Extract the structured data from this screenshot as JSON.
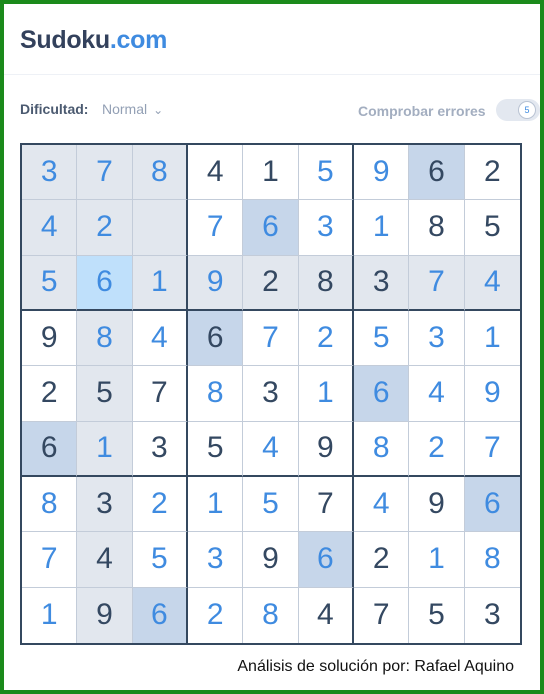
{
  "header": {
    "logo_text": "Sudoku",
    "logo_suffix": ".com"
  },
  "toolbar": {
    "difficulty_label": "Dificultad:",
    "difficulty_value": "Normal",
    "check_errors_label": "Comprobar errores",
    "check_errors_toggle_glyph": "5"
  },
  "board": {
    "rows": [
      [
        {
          "v": "3",
          "t": "user",
          "bg": "hl"
        },
        {
          "v": "7",
          "t": "user",
          "bg": "hl"
        },
        {
          "v": "8",
          "t": "user",
          "bg": "hl"
        },
        {
          "v": "4",
          "t": "given",
          "bg": ""
        },
        {
          "v": "1",
          "t": "given",
          "bg": ""
        },
        {
          "v": "5",
          "t": "user",
          "bg": ""
        },
        {
          "v": "9",
          "t": "user",
          "bg": ""
        },
        {
          "v": "6",
          "t": "given",
          "bg": "same"
        },
        {
          "v": "2",
          "t": "given",
          "bg": ""
        }
      ],
      [
        {
          "v": "4",
          "t": "user",
          "bg": "hl"
        },
        {
          "v": "2",
          "t": "user",
          "bg": "hl"
        },
        {
          "v": "",
          "t": "user",
          "bg": "hl"
        },
        {
          "v": "7",
          "t": "user",
          "bg": ""
        },
        {
          "v": "6",
          "t": "user",
          "bg": "same"
        },
        {
          "v": "3",
          "t": "user",
          "bg": ""
        },
        {
          "v": "1",
          "t": "user",
          "bg": ""
        },
        {
          "v": "8",
          "t": "given",
          "bg": ""
        },
        {
          "v": "5",
          "t": "given",
          "bg": ""
        }
      ],
      [
        {
          "v": "5",
          "t": "user",
          "bg": "hl"
        },
        {
          "v": "6",
          "t": "user",
          "bg": "sel"
        },
        {
          "v": "1",
          "t": "user",
          "bg": "hl"
        },
        {
          "v": "9",
          "t": "user",
          "bg": "hl"
        },
        {
          "v": "2",
          "t": "given",
          "bg": "hl"
        },
        {
          "v": "8",
          "t": "given",
          "bg": "hl"
        },
        {
          "v": "3",
          "t": "given",
          "bg": "hl"
        },
        {
          "v": "7",
          "t": "user",
          "bg": "hl"
        },
        {
          "v": "4",
          "t": "user",
          "bg": "hl"
        }
      ],
      [
        {
          "v": "9",
          "t": "given",
          "bg": ""
        },
        {
          "v": "8",
          "t": "user",
          "bg": "hl"
        },
        {
          "v": "4",
          "t": "user",
          "bg": ""
        },
        {
          "v": "6",
          "t": "given",
          "bg": "same"
        },
        {
          "v": "7",
          "t": "user",
          "bg": ""
        },
        {
          "v": "2",
          "t": "user",
          "bg": ""
        },
        {
          "v": "5",
          "t": "user",
          "bg": ""
        },
        {
          "v": "3",
          "t": "user",
          "bg": ""
        },
        {
          "v": "1",
          "t": "user",
          "bg": ""
        }
      ],
      [
        {
          "v": "2",
          "t": "given",
          "bg": ""
        },
        {
          "v": "5",
          "t": "given",
          "bg": "hl"
        },
        {
          "v": "7",
          "t": "given",
          "bg": ""
        },
        {
          "v": "8",
          "t": "user",
          "bg": ""
        },
        {
          "v": "3",
          "t": "given",
          "bg": ""
        },
        {
          "v": "1",
          "t": "user",
          "bg": ""
        },
        {
          "v": "6",
          "t": "user",
          "bg": "same"
        },
        {
          "v": "4",
          "t": "user",
          "bg": ""
        },
        {
          "v": "9",
          "t": "user",
          "bg": ""
        }
      ],
      [
        {
          "v": "6",
          "t": "given",
          "bg": "same"
        },
        {
          "v": "1",
          "t": "user",
          "bg": "hl"
        },
        {
          "v": "3",
          "t": "given",
          "bg": ""
        },
        {
          "v": "5",
          "t": "given",
          "bg": ""
        },
        {
          "v": "4",
          "t": "user",
          "bg": ""
        },
        {
          "v": "9",
          "t": "given",
          "bg": ""
        },
        {
          "v": "8",
          "t": "user",
          "bg": ""
        },
        {
          "v": "2",
          "t": "user",
          "bg": ""
        },
        {
          "v": "7",
          "t": "user",
          "bg": ""
        }
      ],
      [
        {
          "v": "8",
          "t": "user",
          "bg": ""
        },
        {
          "v": "3",
          "t": "given",
          "bg": "hl"
        },
        {
          "v": "2",
          "t": "user",
          "bg": ""
        },
        {
          "v": "1",
          "t": "user",
          "bg": ""
        },
        {
          "v": "5",
          "t": "user",
          "bg": ""
        },
        {
          "v": "7",
          "t": "given",
          "bg": ""
        },
        {
          "v": "4",
          "t": "user",
          "bg": ""
        },
        {
          "v": "9",
          "t": "given",
          "bg": ""
        },
        {
          "v": "6",
          "t": "user",
          "bg": "same"
        }
      ],
      [
        {
          "v": "7",
          "t": "user",
          "bg": ""
        },
        {
          "v": "4",
          "t": "given",
          "bg": "hl"
        },
        {
          "v": "5",
          "t": "user",
          "bg": ""
        },
        {
          "v": "3",
          "t": "user",
          "bg": ""
        },
        {
          "v": "9",
          "t": "given",
          "bg": ""
        },
        {
          "v": "6",
          "t": "user",
          "bg": "same"
        },
        {
          "v": "2",
          "t": "given",
          "bg": ""
        },
        {
          "v": "1",
          "t": "user",
          "bg": ""
        },
        {
          "v": "8",
          "t": "user",
          "bg": ""
        }
      ],
      [
        {
          "v": "1",
          "t": "user",
          "bg": ""
        },
        {
          "v": "9",
          "t": "given",
          "bg": "hl"
        },
        {
          "v": "6",
          "t": "user",
          "bg": "same"
        },
        {
          "v": "2",
          "t": "user",
          "bg": ""
        },
        {
          "v": "8",
          "t": "user",
          "bg": ""
        },
        {
          "v": "4",
          "t": "given",
          "bg": ""
        },
        {
          "v": "7",
          "t": "given",
          "bg": ""
        },
        {
          "v": "5",
          "t": "given",
          "bg": ""
        },
        {
          "v": "3",
          "t": "given",
          "bg": ""
        }
      ]
    ]
  },
  "footer": {
    "credit": "Análisis de solución por: Rafael Aquino"
  },
  "colors": {
    "frame_border": "#1b8a1b",
    "given_digit": "#344861",
    "user_digit": "#3f8be0",
    "highlight_bg": "#e2e7ee",
    "same_number_bg": "#c6d6ea",
    "selected_bg": "#bfe0fb"
  }
}
